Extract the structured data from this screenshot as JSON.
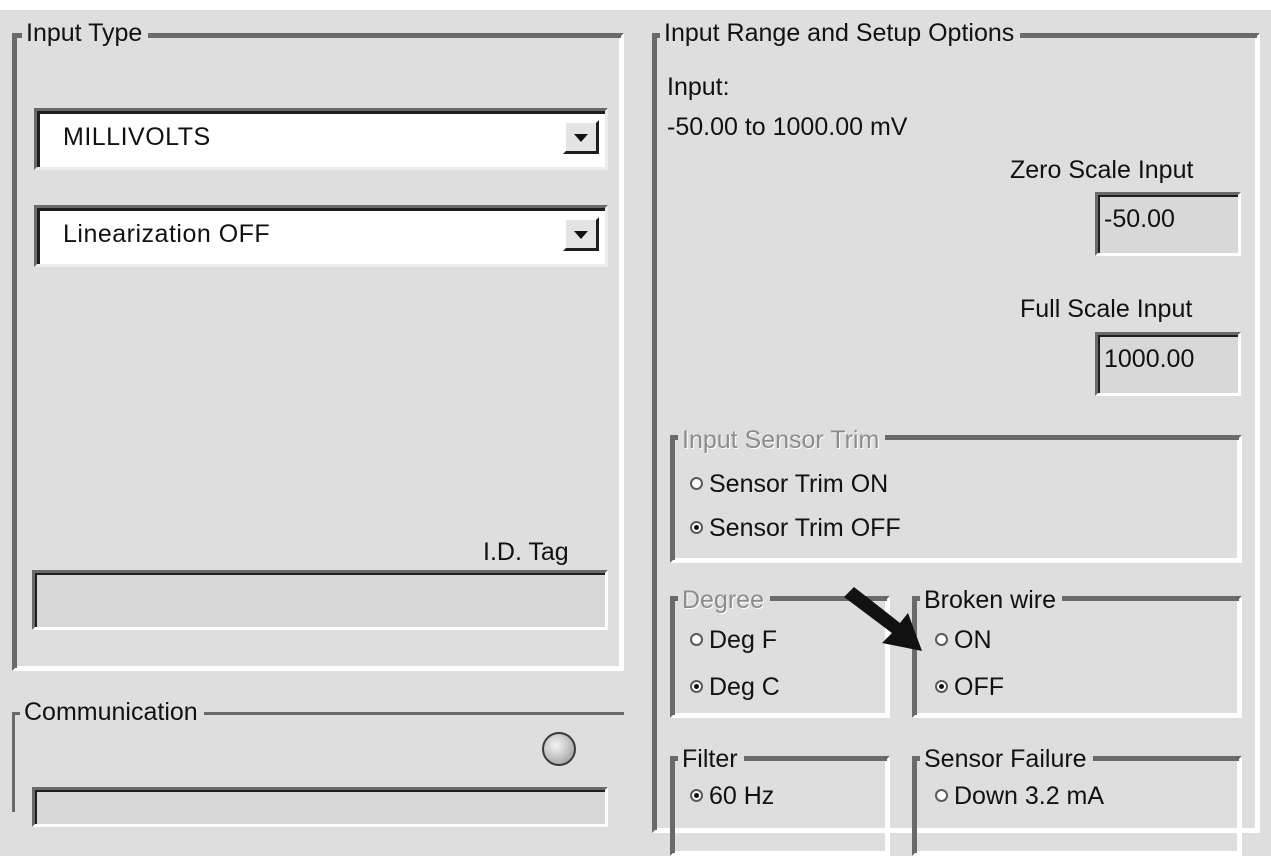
{
  "input_type": {
    "legend": "Input Type",
    "type_select": "MILLIVOLTS",
    "linearization_select": "Linearization OFF",
    "id_tag_label": "I.D. Tag",
    "id_tag_value": ""
  },
  "communication": {
    "legend": "Communication"
  },
  "range_options": {
    "legend": "Input Range and Setup Options",
    "input_label": "Input:",
    "input_range": "-50.00 to 1000.00 mV",
    "zero_scale_label": "Zero Scale Input",
    "zero_scale_value": "-50.00",
    "full_scale_label": "Full Scale Input",
    "full_scale_value": "1000.00"
  },
  "sensor_trim": {
    "legend": "Input Sensor Trim",
    "opt_on": "Sensor Trim ON",
    "opt_off": "Sensor Trim OFF",
    "selected": "off"
  },
  "degree": {
    "legend": "Degree",
    "opt_f": "Deg F",
    "opt_c": "Deg C",
    "selected": "c"
  },
  "broken_wire": {
    "legend": "Broken wire",
    "opt_on": "ON",
    "opt_off": "OFF",
    "selected": "off"
  },
  "filter": {
    "legend": "Filter",
    "opt_60": "60 Hz"
  },
  "sensor_failure": {
    "legend": "Sensor Failure",
    "opt_down": "Down 3.2 mA"
  },
  "colors": {
    "background": "#dedede",
    "arrow": "#111111"
  },
  "icons": {
    "status_led": "led-icon",
    "annotation_arrow": "arrow-icon"
  }
}
